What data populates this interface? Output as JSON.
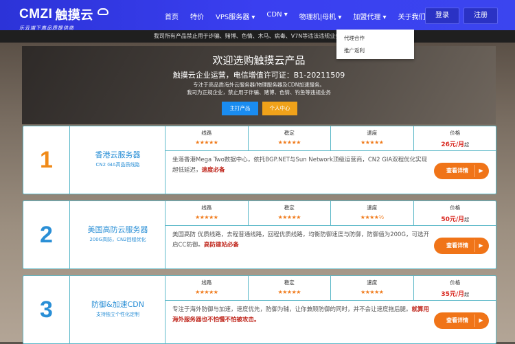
{
  "nav": {
    "logo_text": "CMZI",
    "logo_cn": "触摸云",
    "slogan": "乐云端下高品质提供商",
    "menu": [
      "首页",
      "特价",
      "VPS服务器 ▾",
      "CDN ▾",
      "物理机|母机 ▾",
      "加盟代理 ▾",
      "关于我们 ▾"
    ],
    "login": "登录",
    "register": "注册"
  },
  "notice": "我司所有产品禁止用于诈骗、赌博、色情、木马、病毒、V7N等违法违规业务，违者将封",
  "dropdown": [
    "代理合作",
    "推广返利"
  ],
  "hero": {
    "title": "欢迎选购触摸云产品",
    "license": "触摸云企业运营，电信增值许可证：B1-20211509",
    "line1": "专注于高品质海外云服务器/物理服务器及CDN加速服务。",
    "line2": "我司为正规企业，禁止用于诈骗、赌博、色情、钓鱼等违规业务",
    "btn1": "主打产品",
    "btn2": "个人中心"
  },
  "cards": [
    {
      "num": "1",
      "num_color": "#f08a18",
      "name": "香港云服务器",
      "sub": "CN2 GIA高品质线路",
      "h1": "线路",
      "s1": "★★★★★",
      "h2": "稳定",
      "s2": "★★★★★",
      "h3": "速度",
      "s3": "★★★★★",
      "h4": "价格",
      "price": "26元/月",
      "price_unit": "起",
      "desc": "坐落香港Mega Two数据中心，依托BGP.NET与Sun Network顶级运营商，CN2 GIA双程优化实现超低延迟，",
      "desc_bold": "速度必备",
      "more": "查看详情"
    },
    {
      "num": "2",
      "num_color": "#2a8fd6",
      "name": "美国高防云服务器",
      "sub": "200G高防，CN2回程优化",
      "h1": "线路",
      "s1": "★★★★★",
      "h2": "稳定",
      "s2": "★★★★★",
      "h3": "速度",
      "s3": "★★★★½",
      "h4": "价格",
      "price": "50元/月",
      "price_unit": "起",
      "desc": "美国高防 优质线路，去程普通线路，回程优质线路，均衡防御速度与防御，防御值为200G，可选开启CC防御。",
      "desc_bold": "高防建站必备",
      "more": "查看详情"
    },
    {
      "num": "3",
      "num_color": "#2a8fd6",
      "name": "防御&加速CDN",
      "sub": "支持独立个性化定制",
      "h1": "线路",
      "s1": "★★★★★",
      "h2": "稳定",
      "s2": "★★★★★",
      "h3": "速度",
      "s3": "★★★★★",
      "h4": "价格",
      "price": "35元/月",
      "price_unit": "起",
      "desc": "专注于海外防御与加速，速度优先，防御为辅，让你兼顾防御的同时，并不会让速度拖后腿。",
      "desc_bold": "就算用海外服务器也不怕慢不怕被攻击。",
      "more": "查看详情"
    }
  ]
}
